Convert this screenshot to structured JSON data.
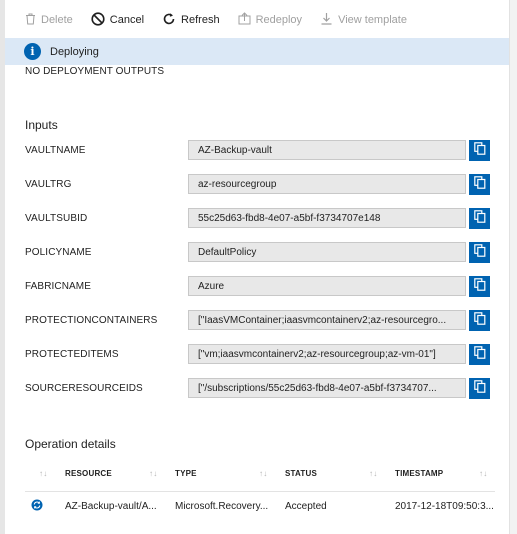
{
  "toolbar": {
    "delete_label": "Delete",
    "cancel_label": "Cancel",
    "refresh_label": "Refresh",
    "redeploy_label": "Redeploy",
    "view_template_label": "View template"
  },
  "banner": {
    "status_text": "Deploying",
    "icon": "info-icon"
  },
  "outputs_note": "NO DEPLOYMENT OUTPUTS",
  "inputs": {
    "title": "Inputs",
    "rows": [
      {
        "label": "VAULTNAME",
        "value": "AZ-Backup-vault"
      },
      {
        "label": "VAULTRG",
        "value": "az-resourcegroup"
      },
      {
        "label": "VAULTSUBID",
        "value": "55c25d63-fbd8-4e07-a5bf-f3734707e148"
      },
      {
        "label": "POLICYNAME",
        "value": "DefaultPolicy"
      },
      {
        "label": "FABRICNAME",
        "value": "Azure"
      },
      {
        "label": "PROTECTIONCONTAINERS",
        "value": "[\"IaasVMContainer;iaasvmcontainerv2;az-resourcegro..."
      },
      {
        "label": "PROTECTEDITEMS",
        "value": "[\"vm;iaasvmcontainerv2;az-resourcegroup;az-vm-01\"]"
      },
      {
        "label": "SOURCERESOURCEIDS",
        "value": "[\"/subscriptions/55c25d63-fbd8-4e07-a5bf-f3734707..."
      }
    ]
  },
  "operation_details": {
    "title": "Operation details",
    "columns": [
      "RESOURCE",
      "TYPE",
      "STATUS",
      "TIMESTAMP"
    ],
    "rows": [
      {
        "resource": "AZ-Backup-vault/A...",
        "type": "Microsoft.Recovery...",
        "status": "Accepted",
        "timestamp": "2017-12-18T09:50:3..."
      }
    ]
  },
  "colors": {
    "accent": "#0063b1",
    "banner_bg": "#dbe8f6",
    "field_bg": "#e8e8e8",
    "disabled_text": "#a0a0a0"
  }
}
